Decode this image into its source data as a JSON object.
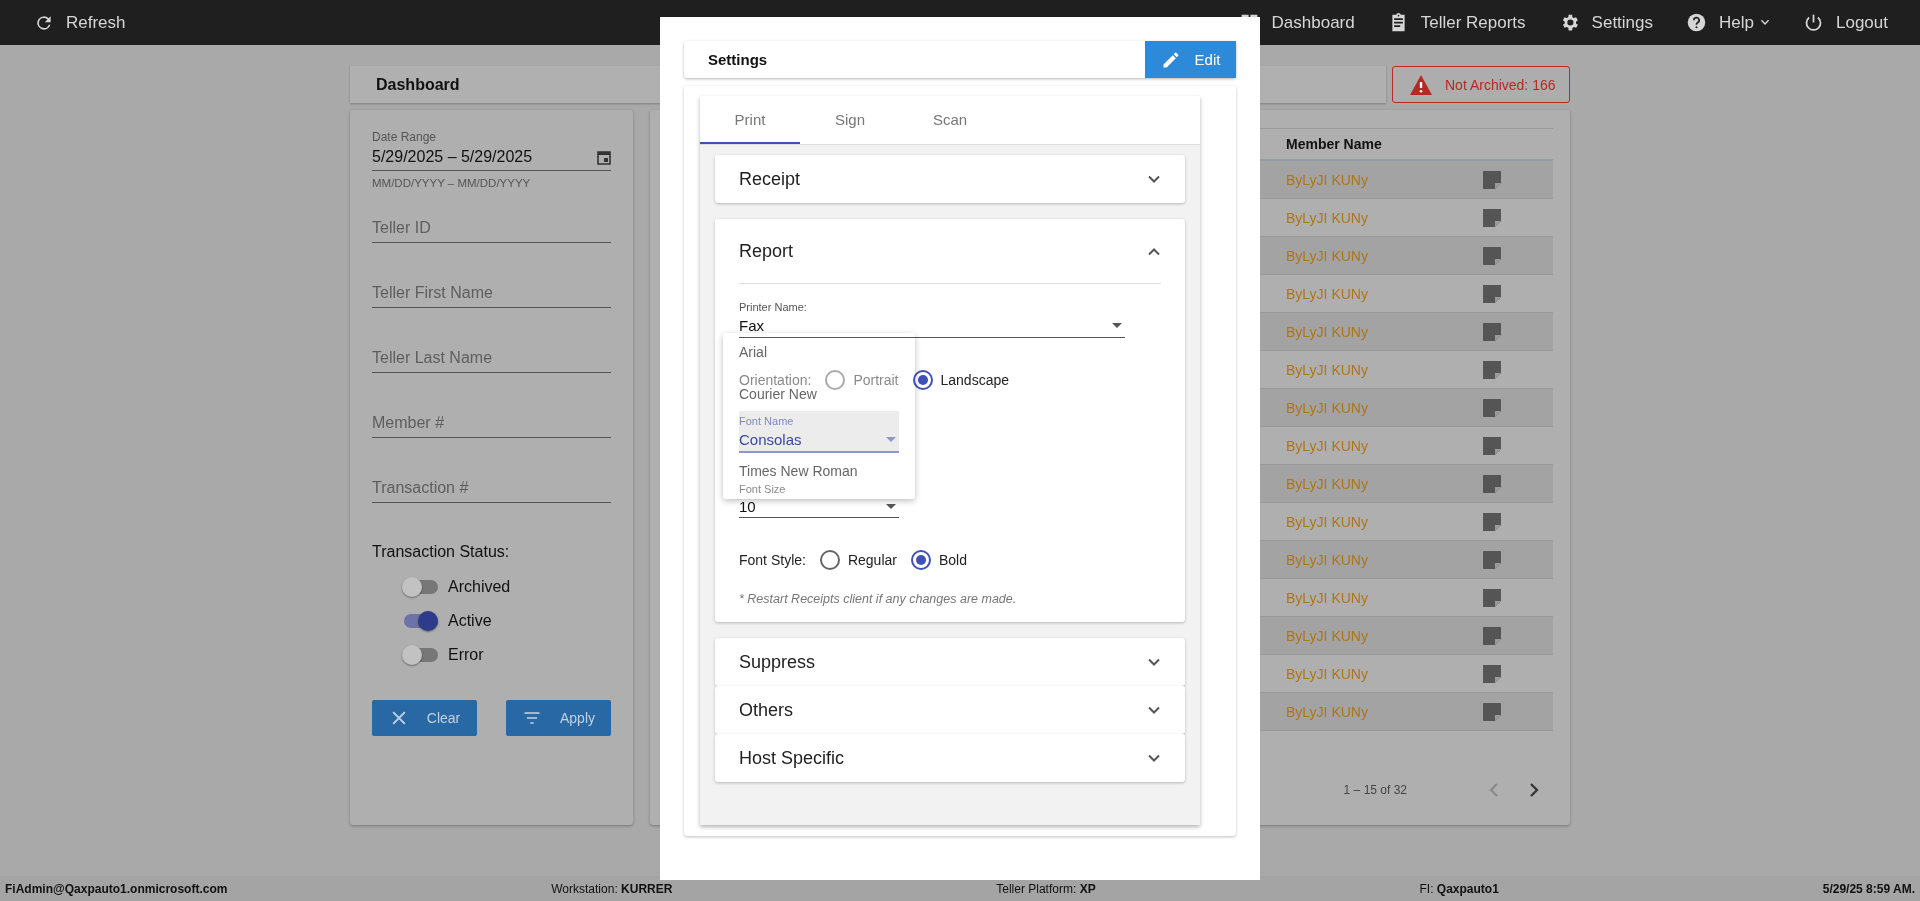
{
  "top_bar": {
    "refresh": {
      "label": "Refresh"
    },
    "nav": [
      {
        "label": "Dashboard",
        "dropdown": false
      },
      {
        "label": "Teller Reports",
        "dropdown": false
      },
      {
        "label": "Settings",
        "dropdown": false
      },
      {
        "label": "Help",
        "dropdown": true
      },
      {
        "label": "Logout",
        "dropdown": false
      }
    ]
  },
  "dashboard": {
    "title": "Dashboard",
    "alert": {
      "label": "Not Archived: 166"
    }
  },
  "filters": {
    "date_range": {
      "label": "Date Range",
      "value": "5/29/2025 – 5/29/2025",
      "hint": "MM/DD/YYYY – MM/DD/YYYY"
    },
    "fields": [
      {
        "placeholder": "Teller ID"
      },
      {
        "placeholder": "Teller First Name"
      },
      {
        "placeholder": "Teller Last Name"
      },
      {
        "placeholder": "Member #"
      },
      {
        "placeholder": "Transaction #"
      }
    ],
    "status": {
      "label": "Transaction Status:",
      "toggles": [
        {
          "label": "Archived",
          "on": false
        },
        {
          "label": "Active",
          "on": true
        },
        {
          "label": "Error",
          "on": false
        }
      ]
    },
    "buttons": [
      {
        "label": "Clear"
      },
      {
        "label": "Apply"
      }
    ]
  },
  "table": {
    "columns": [
      "Member Name"
    ],
    "rows": [
      {
        "member_name": "ByLyJI KUNy"
      },
      {
        "member_name": "ByLyJI KUNy"
      },
      {
        "member_name": "ByLyJI KUNy"
      },
      {
        "member_name": "ByLyJI KUNy"
      },
      {
        "member_name": "ByLyJI KUNy"
      },
      {
        "member_name": "ByLyJI KUNy"
      },
      {
        "member_name": "ByLyJI KUNy"
      },
      {
        "member_name": "ByLyJI KUNy"
      },
      {
        "member_name": "ByLyJI KUNy"
      },
      {
        "member_name": "ByLyJI KUNy"
      },
      {
        "member_name": "ByLyJI KUNy"
      },
      {
        "member_name": "ByLyJI KUNy"
      },
      {
        "member_name": "ByLyJI KUNy"
      },
      {
        "member_name": "ByLyJI KUNy"
      },
      {
        "member_name": "ByLyJI KUNy"
      }
    ],
    "pagination": {
      "range": "1 – 15 of 32",
      "buttons": [
        {
          "kind": "prev",
          "disabled": true
        },
        {
          "kind": "next",
          "disabled": false
        }
      ]
    }
  },
  "modal": {
    "title": "Settings",
    "edit_button": {
      "label": "Edit"
    },
    "tabs": [
      {
        "label": "Print",
        "selected": true
      },
      {
        "label": "Sign",
        "selected": false
      },
      {
        "label": "Scan",
        "selected": false
      }
    ],
    "panels": [
      {
        "title": "Receipt",
        "expanded": false
      },
      {
        "title": "Report",
        "expanded": true
      },
      {
        "title": "Suppress",
        "expanded": false
      },
      {
        "title": "Others",
        "expanded": false
      },
      {
        "title": "Host Specific",
        "expanded": false
      }
    ],
    "report": {
      "printer": {
        "label": "Printer Name:",
        "value": "Fax"
      },
      "orientation": {
        "label": "Orientation:",
        "options": [
          {
            "label": "Portrait",
            "selected": false
          },
          {
            "label": "Landscape",
            "selected": true
          }
        ]
      },
      "font_name": {
        "label": "Font Name",
        "value": "Consolas"
      },
      "font_size": {
        "label": "Font Size",
        "value": "10"
      },
      "font_style": {
        "label": "Font Style:",
        "options": [
          {
            "label": "Regular",
            "selected": false
          },
          {
            "label": "Bold",
            "selected": true
          }
        ]
      },
      "note": "* Restart Receipts client if any changes are made.",
      "font_menu": [
        {
          "label": "Arial",
          "selected": false
        },
        {
          "label": "Courier New",
          "selected": false
        },
        {
          "label": "Times New Roman",
          "selected": false
        }
      ]
    }
  },
  "status_bar": [
    "**FiAdmin@Qaxpauto1.onmicrosoft.com**",
    "Workstation: **KURRER**",
    "Teller Platform: **XP**",
    "FI: **Qaxpauto1**",
    "**5/29/25 8:59 AM.**"
  ]
}
